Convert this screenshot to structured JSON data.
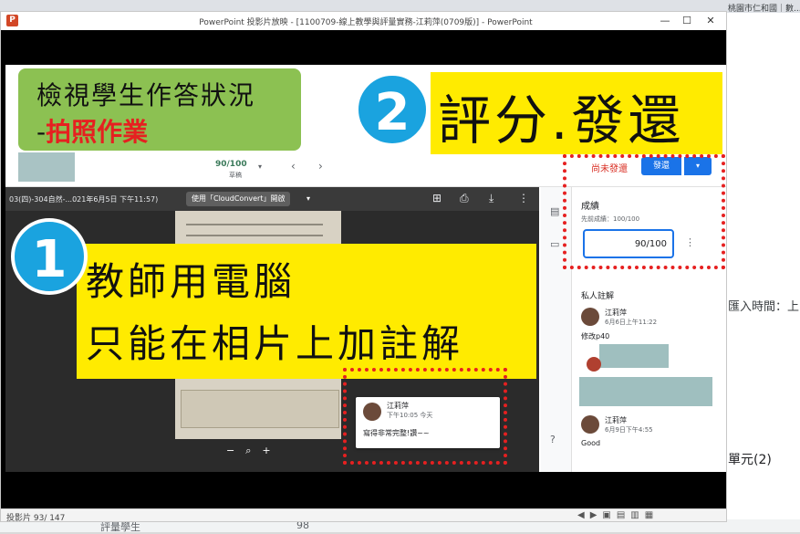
{
  "background": {
    "tab_text": "桃園市仁和國｜數...",
    "right_text_1": "匯入時間：上",
    "right_text_2": "單元(2)",
    "bottom_left_text": "評量學生",
    "bottom_num": "98"
  },
  "window": {
    "app_icon": "P",
    "title": "PowerPoint 投影片放映 - [1100709-線上教學與評量實務-江莉萍(0709版)] - PowerPoint",
    "minimize": "—",
    "maximize": "☐",
    "close": "✕"
  },
  "statusbar": {
    "slide_count": "投影片 93/ 147",
    "icons": "◀▶▣▤▥▦"
  },
  "classroom": {
    "score": "90/100",
    "status": "草稿",
    "caret": "▾",
    "prev": "‹",
    "next": "›",
    "unreturn": "尚未發還",
    "return": "發還",
    "return_caret": "▾"
  },
  "viewer": {
    "file_name": "03(四)-304自然-...021年6月5日 下午11:57)",
    "open_with": "使用「CloudConvert」開啟",
    "open_caret": "▾",
    "icons": {
      "add": "⊞",
      "print": "⎙",
      "download": "⤓",
      "more": "⋮"
    },
    "zoom": "−⌕+"
  },
  "panel": {
    "grade_label": "成績",
    "grade_prev": "先前成績：100/100",
    "grade_value": "90/100",
    "more": "⋮",
    "private_label": "私人註解",
    "comments": [
      {
        "name": "江莉萍",
        "time": "6月6日上午11:22",
        "text": "修改p40"
      },
      {
        "name": "江莉萍",
        "time": "6月9日下午4:55",
        "text": "Good"
      }
    ],
    "side_icons": {
      "doc": "▤",
      "chat": "▭",
      "help": "?"
    }
  },
  "popup": {
    "name": "江莉萍",
    "time": "下午10:05 今天",
    "text": "寫得非常完整!讚~~"
  },
  "annotations": {
    "green_line1": "檢視學生作答狀況",
    "green_line2_prefix": "-",
    "green_line2_red": "拍照作業",
    "num2": "2",
    "title2": "評分.發還",
    "num1": "1",
    "yellow_line1": "教師用電腦",
    "yellow_line2": "只能在相片上加註解"
  },
  "colors": {
    "accent_blue": "#1a73e8",
    "annotation_red": "#e62020",
    "annotation_yellow": "#ffeb00",
    "annotation_green": "#8cc152",
    "number_circle": "#1aa3df"
  }
}
